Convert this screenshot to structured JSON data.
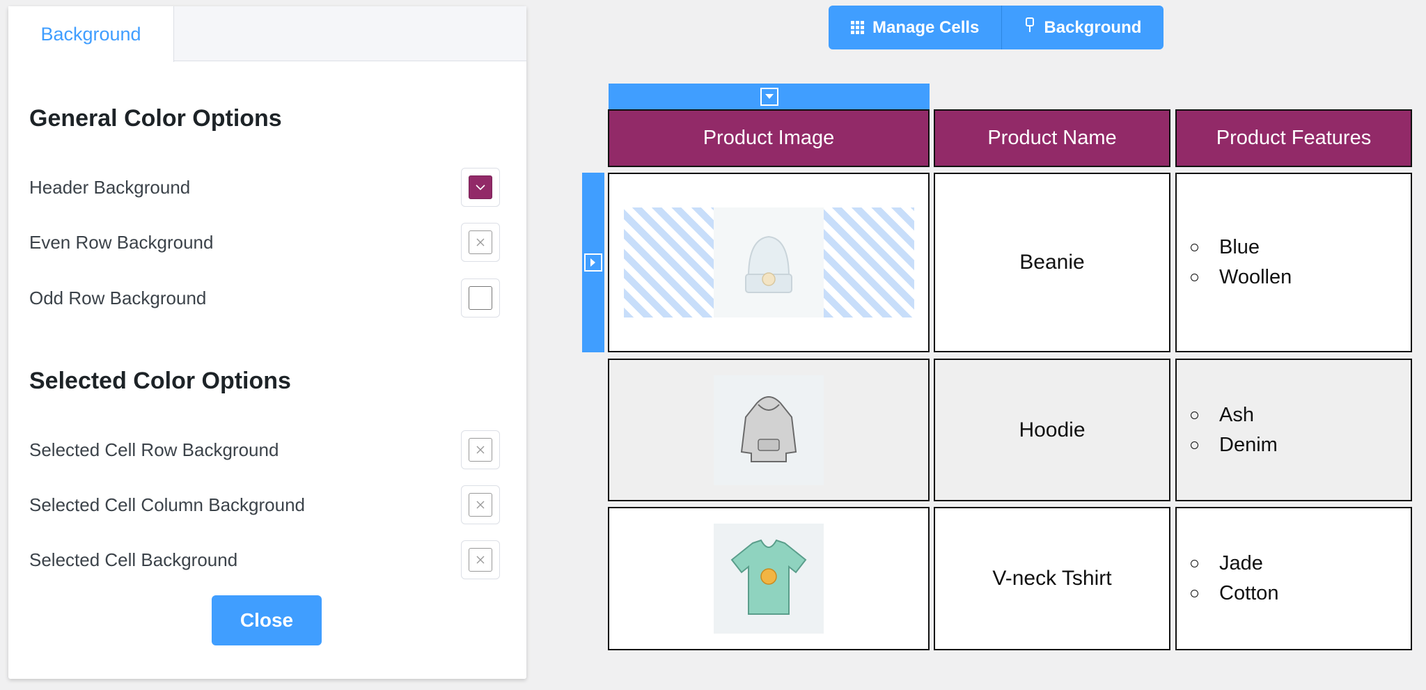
{
  "panel": {
    "tab_label": "Background",
    "general_title": "General Color Options",
    "general_options": [
      {
        "label": "Header Background",
        "color": "#922a68",
        "state": "set"
      },
      {
        "label": "Even Row Background",
        "state": "empty"
      },
      {
        "label": "Odd Row Background",
        "state": "plain"
      }
    ],
    "selected_title": "Selected Color Options",
    "selected_options": [
      {
        "label": "Selected Cell Row Background",
        "state": "empty"
      },
      {
        "label": "Selected Cell Column Background",
        "state": "empty"
      },
      {
        "label": "Selected Cell Background",
        "state": "empty"
      }
    ],
    "close_label": "Close"
  },
  "toolbar": {
    "manage_cells_label": "Manage Cells",
    "background_label": "Background"
  },
  "table": {
    "headers": [
      "Product Image",
      "Product Name",
      "Product Features"
    ],
    "rows": [
      {
        "name": "Beanie",
        "features": [
          "Blue",
          "Woollen"
        ],
        "image_icon": "beanie-image"
      },
      {
        "name": "Hoodie",
        "features": [
          "Ash",
          "Denim"
        ],
        "image_icon": "hoodie-image"
      },
      {
        "name": "V-neck Tshirt",
        "features": [
          "Jade",
          "Cotton"
        ],
        "image_icon": "tshirt-image"
      }
    ]
  },
  "colors": {
    "accent": "#409eff",
    "header_bg": "#922a68",
    "even_row_bg": "#efefef"
  }
}
